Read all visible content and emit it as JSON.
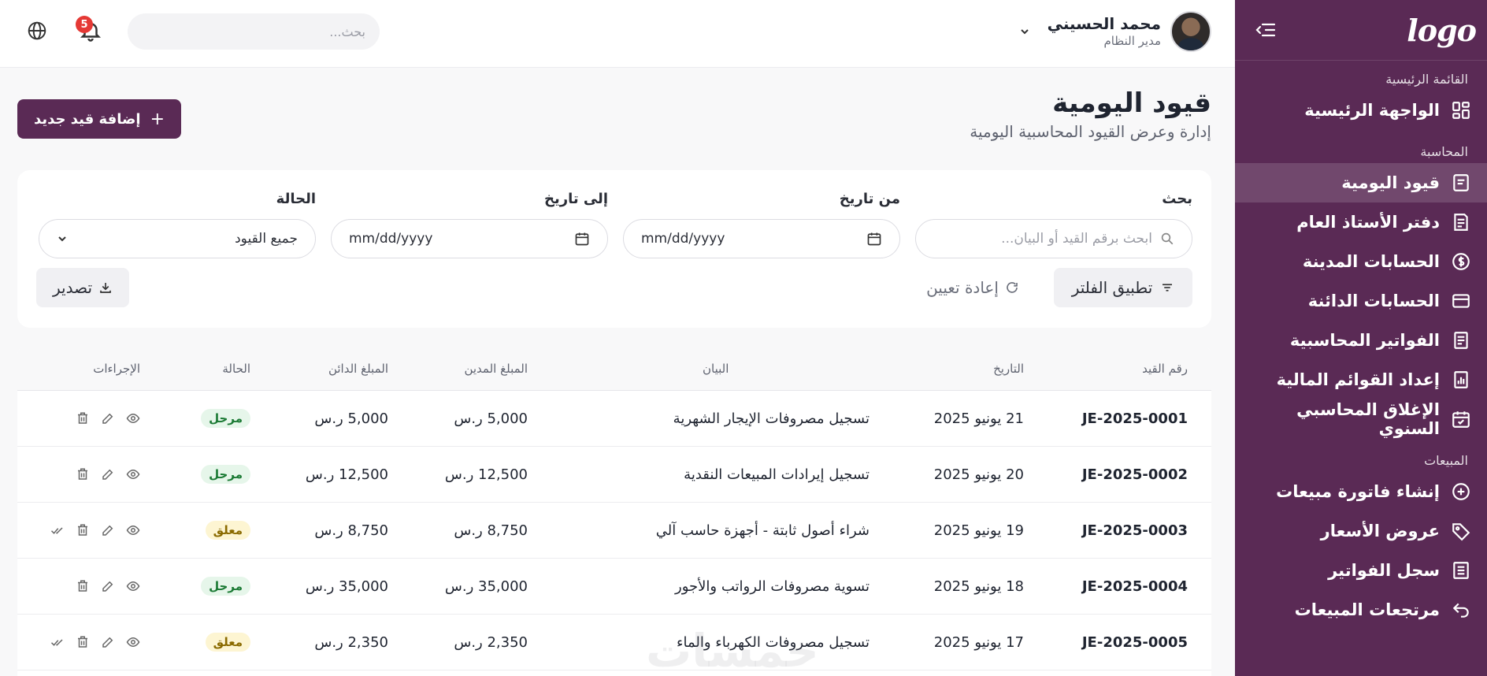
{
  "brand": {
    "logo": "logo",
    "sidebar_color": "#5a2a55"
  },
  "sidebar": {
    "sections": [
      {
        "title": "القائمة الرئيسية",
        "items": [
          {
            "label": "الواجهة الرئيسية",
            "icon": "dashboard-icon"
          }
        ]
      },
      {
        "title": "المحاسبة",
        "items": [
          {
            "label": "قيود اليومية",
            "icon": "journal-icon",
            "active": true
          },
          {
            "label": "دفتر الأستاذ العام",
            "icon": "ledger-icon"
          },
          {
            "label": "الحسابات المدينة",
            "icon": "dollar-circle-icon"
          },
          {
            "label": "الحسابات الدائنة",
            "icon": "card-icon"
          },
          {
            "label": "الفواتير المحاسبية",
            "icon": "invoice-icon"
          },
          {
            "label": "إعداد القوائم المالية",
            "icon": "report-icon"
          },
          {
            "label": "الإغلاق المحاسبي السنوي",
            "icon": "calendar-check-icon"
          }
        ]
      },
      {
        "title": "المبيعات",
        "items": [
          {
            "label": "إنشاء فاتورة مبيعات",
            "icon": "plus-circle-icon"
          },
          {
            "label": "عروض الأسعار",
            "icon": "tag-icon"
          },
          {
            "label": "سجل الفواتير",
            "icon": "list-doc-icon"
          },
          {
            "label": "مرتجعات المبيعات",
            "icon": "return-icon"
          }
        ]
      }
    ]
  },
  "header": {
    "user": {
      "name": "محمد الحسيني",
      "role": "مدير النظام"
    },
    "search_placeholder": "بحث...",
    "notifications_count": "5"
  },
  "page": {
    "title": "قيود اليومية",
    "subtitle": "إدارة وعرض القيود المحاسبية اليومية",
    "add_button": "إضافة قيد جديد"
  },
  "filters": {
    "search_label": "بحث",
    "search_placeholder": "ابحث برقم القيد أو البيان...",
    "from_label": "من تاريخ",
    "to_label": "إلى تاريخ",
    "date_placeholder": "mm/dd/yyyy",
    "status_label": "الحالة",
    "status_value": "جميع القيود",
    "apply": "تطبيق الفلتر",
    "reset": "إعادة تعيين",
    "export": "تصدير"
  },
  "table": {
    "columns": {
      "id": "رقم القيد",
      "date": "التاريخ",
      "desc": "البيان",
      "debit": "المبلغ المدين",
      "credit": "المبلغ الدائن",
      "status": "الحالة",
      "actions": "الإجراءات"
    },
    "rows": [
      {
        "id": "JE-2025-0001",
        "date": "21 يونيو 2025",
        "desc": "تسجيل مصروفات الإيجار الشهرية",
        "debit": "5,000 ر.س",
        "credit": "5,000 ر.س",
        "status": "مرحل",
        "status_type": "posted"
      },
      {
        "id": "JE-2025-0002",
        "date": "20 يونيو 2025",
        "desc": "تسجيل إيرادات المبيعات النقدية",
        "debit": "12,500 ر.س",
        "credit": "12,500 ر.س",
        "status": "مرحل",
        "status_type": "posted"
      },
      {
        "id": "JE-2025-0003",
        "date": "19 يونيو 2025",
        "desc": "شراء أصول ثابتة - أجهزة حاسب آلي",
        "debit": "8,750 ر.س",
        "credit": "8,750 ر.س",
        "status": "معلق",
        "status_type": "pending"
      },
      {
        "id": "JE-2025-0004",
        "date": "18 يونيو 2025",
        "desc": "تسوية مصروفات الرواتب والأجور",
        "debit": "35,000 ر.س",
        "credit": "35,000 ر.س",
        "status": "مرحل",
        "status_type": "posted"
      },
      {
        "id": "JE-2025-0005",
        "date": "17 يونيو 2025",
        "desc": "تسجيل مصروفات الكهرباء والماء",
        "debit": "2,350 ر.س",
        "credit": "2,350 ر.س",
        "status": "معلق",
        "status_type": "pending"
      }
    ]
  },
  "watermark": "خمسات"
}
